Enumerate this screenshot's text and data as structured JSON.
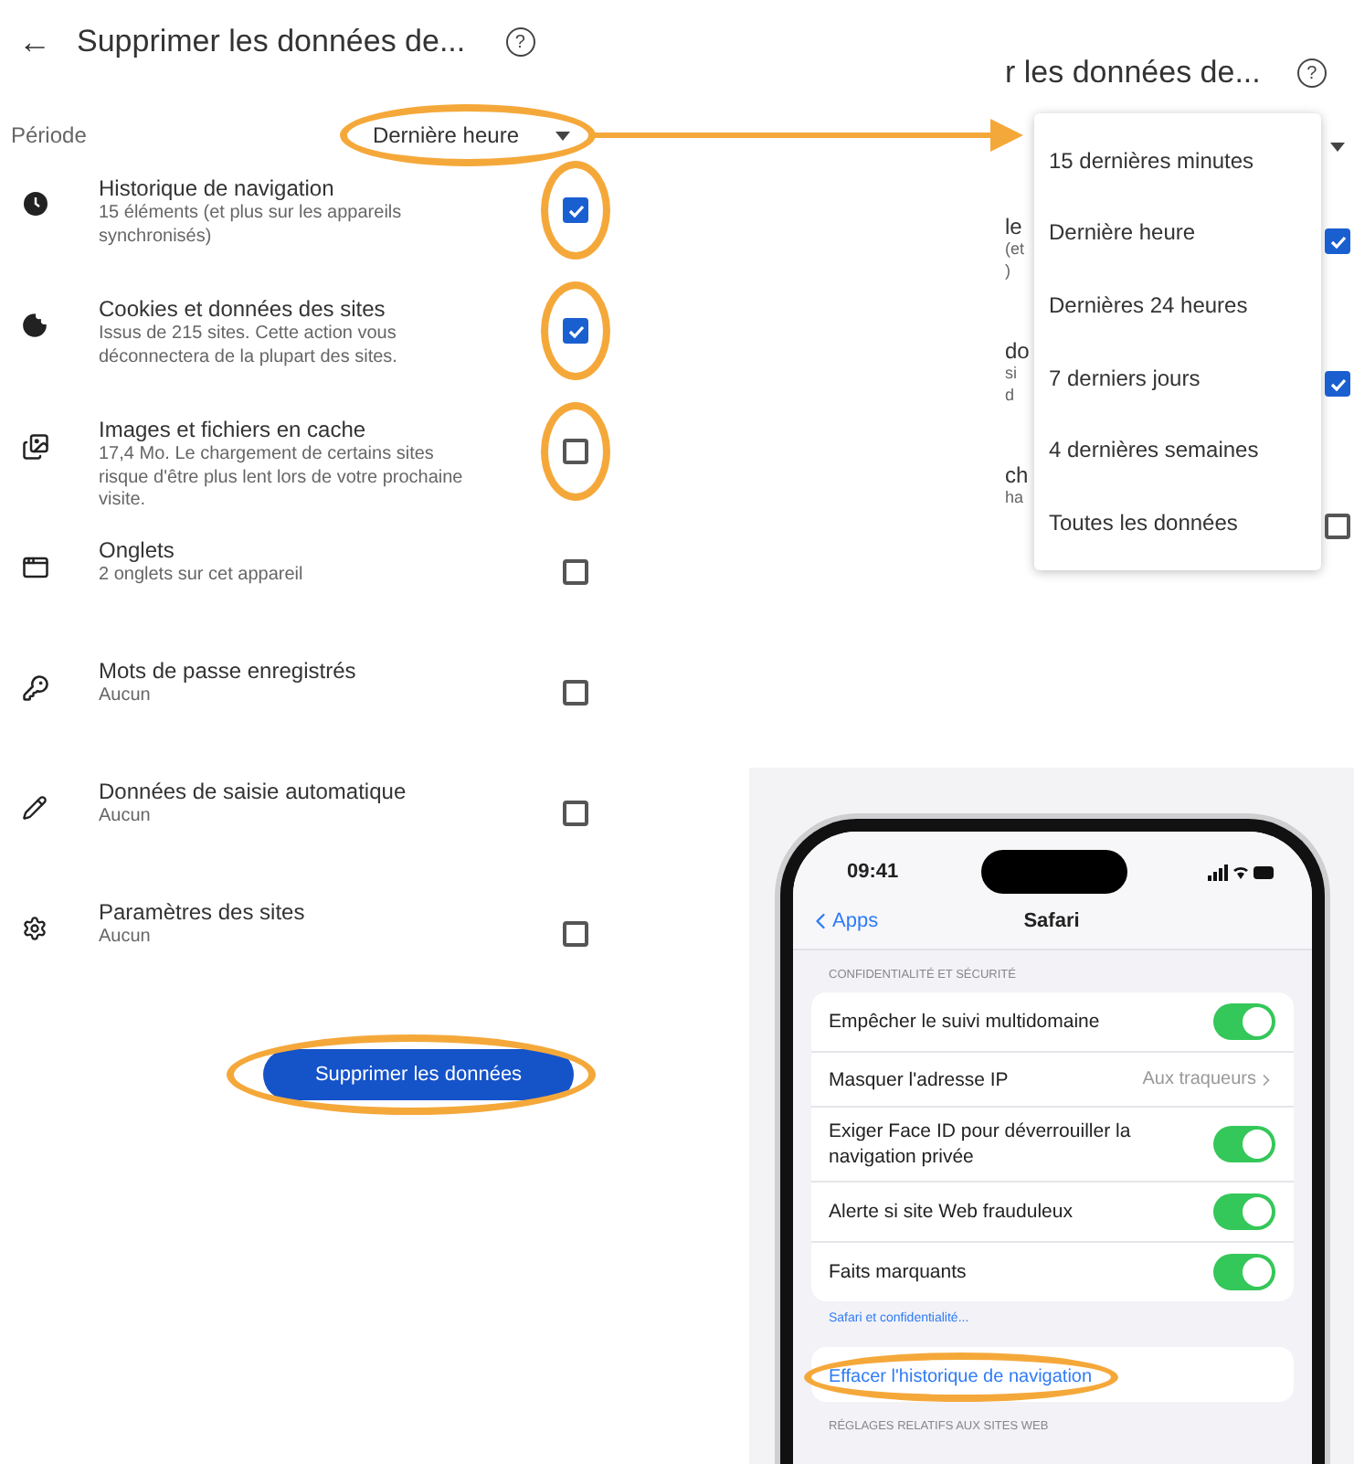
{
  "left_panel": {
    "back": "←",
    "title": "Supprimer les données de...",
    "help": "?",
    "period": {
      "label": "Période",
      "value": "Dernière heure",
      "highlighted": true
    },
    "items": [
      {
        "title": "Historique de navigation",
        "subtitle": "15 éléments (et plus sur les appareils synchronisés)",
        "checked": true,
        "highlighted": true
      },
      {
        "title": "Cookies et données des sites",
        "subtitle": "Issus de 215 sites. Cette action vous déconnectera de la plupart des sites.",
        "checked": true,
        "highlighted": true
      },
      {
        "title": "Images et fichiers en cache",
        "subtitle": "17,4 Mo. Le chargement de certains sites risque d'être plus lent lors de votre prochaine visite.",
        "checked": false,
        "highlighted": true
      },
      {
        "title": "Onglets",
        "subtitle": "2 onglets sur cet appareil",
        "checked": false,
        "highlighted": false
      },
      {
        "title": "Mots de passe enregistrés",
        "subtitle": "Aucun",
        "checked": false,
        "highlighted": false
      },
      {
        "title": "Données de saisie automatique",
        "subtitle": "Aucun",
        "checked": false,
        "highlighted": false
      },
      {
        "title": "Paramètres des sites",
        "subtitle": "Aucun",
        "checked": false,
        "highlighted": false
      }
    ],
    "button": {
      "label": "Supprimer les données",
      "highlighted": true
    }
  },
  "right_panel": {
    "title": "r les données de...",
    "help": "?",
    "menu_options": [
      "15 dernières minutes",
      "Dernière heure",
      "Dernières 24 heures",
      "7 derniers jours",
      "4 dernières semaines",
      "Toutes les données"
    ],
    "row_fragments": [
      [
        "le",
        "(et",
        ")"
      ],
      [
        "do",
        "si",
        "d"
      ],
      [
        "ch",
        "ha"
      ]
    ],
    "checkboxes": [
      {
        "checked": true
      },
      {
        "checked": true
      },
      {
        "checked": false
      }
    ]
  },
  "phone": {
    "time": "09:41",
    "back": "Apps",
    "title": "Safari",
    "section": "CONFIDENTIALITÉ ET SÉCURITÉ",
    "rows": [
      {
        "kind": "toggle",
        "label": "Empêcher le suivi multidomaine",
        "on": true
      },
      {
        "kind": "value",
        "label": "Masquer l'adresse IP",
        "value": "Aux traqueurs"
      },
      {
        "kind": "toggle",
        "label": "Exiger Face ID pour déverrouiller la navigation privée",
        "on": true
      },
      {
        "kind": "toggle",
        "label": "Alerte si site Web frauduleux",
        "on": true
      },
      {
        "kind": "toggle",
        "label": "Faits marquants",
        "on": true
      }
    ],
    "footer_link": "Safari et confidentialité...",
    "action": {
      "label": "Effacer l'historique de navigation",
      "highlighted": true
    },
    "next_section": "RÉGLAGES RELATIFS AUX SITES WEB"
  }
}
